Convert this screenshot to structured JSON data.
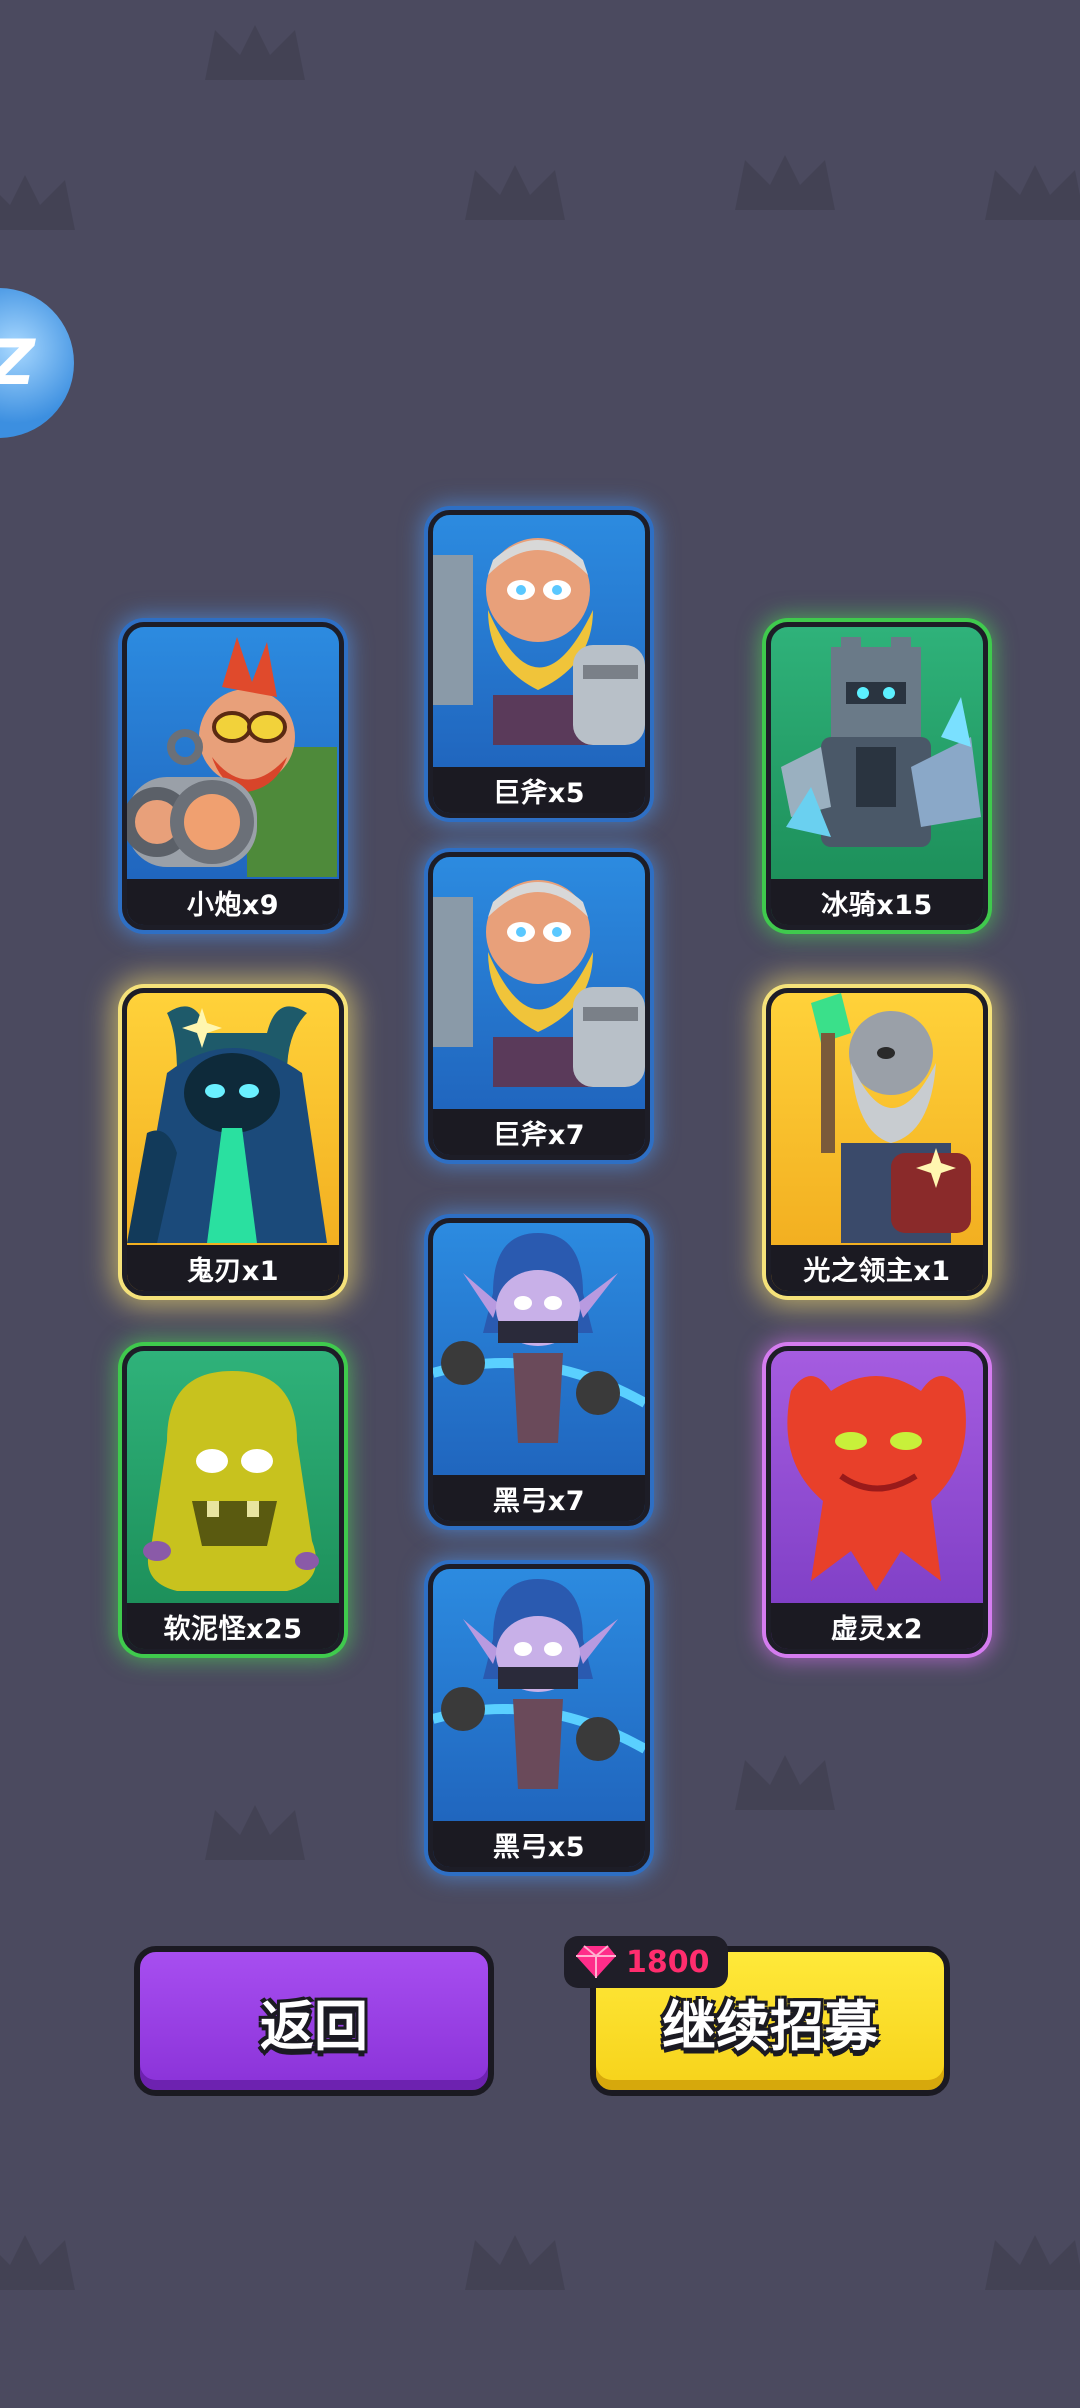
{
  "cards": [
    {
      "id": "cannon",
      "label": "小炮x9",
      "rarity": "blue",
      "icon": "dwarf-cannon-icon"
    },
    {
      "id": "axe1",
      "label": "巨斧x5",
      "rarity": "blue",
      "icon": "bearded-axeman-icon"
    },
    {
      "id": "iceknight",
      "label": "冰骑x15",
      "rarity": "green",
      "icon": "ice-knight-icon"
    },
    {
      "id": "ghostblade",
      "label": "鬼刃x1",
      "rarity": "gold",
      "icon": "shadow-wraith-icon"
    },
    {
      "id": "axe2",
      "label": "巨斧x7",
      "rarity": "blue",
      "icon": "bearded-axeman-icon"
    },
    {
      "id": "lightlord",
      "label": "光之领主x1",
      "rarity": "gold",
      "icon": "old-wizard-icon"
    },
    {
      "id": "slime",
      "label": "软泥怪x25",
      "rarity": "green",
      "icon": "slime-monster-icon"
    },
    {
      "id": "bow1",
      "label": "黑弓x7",
      "rarity": "blue",
      "icon": "elf-archer-icon"
    },
    {
      "id": "spirit",
      "label": "虚灵x2",
      "rarity": "purple",
      "icon": "red-spirit-icon"
    },
    {
      "id": "bow2",
      "label": "黑弓x5",
      "rarity": "blue",
      "icon": "elf-archer-icon"
    }
  ],
  "buttons": {
    "back_label": "返回",
    "recruit_label": "继续招募",
    "recruit_cost": "1800"
  },
  "colors": {
    "background": "#4b4a5f",
    "back_button": "#a74ef0",
    "recruit_button": "#ffe93a",
    "gem": "#ff2d6e"
  }
}
